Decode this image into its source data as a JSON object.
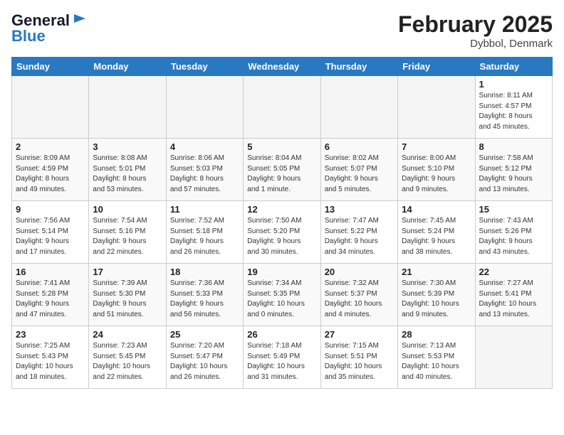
{
  "header": {
    "logo_line1": "General",
    "logo_line2": "Blue",
    "month_title": "February 2025",
    "location": "Dybbol, Denmark"
  },
  "weekdays": [
    "Sunday",
    "Monday",
    "Tuesday",
    "Wednesday",
    "Thursday",
    "Friday",
    "Saturday"
  ],
  "weeks": [
    [
      {
        "day": "",
        "info": ""
      },
      {
        "day": "",
        "info": ""
      },
      {
        "day": "",
        "info": ""
      },
      {
        "day": "",
        "info": ""
      },
      {
        "day": "",
        "info": ""
      },
      {
        "day": "",
        "info": ""
      },
      {
        "day": "1",
        "info": "Sunrise: 8:11 AM\nSunset: 4:57 PM\nDaylight: 8 hours\nand 45 minutes."
      }
    ],
    [
      {
        "day": "2",
        "info": "Sunrise: 8:09 AM\nSunset: 4:59 PM\nDaylight: 8 hours\nand 49 minutes."
      },
      {
        "day": "3",
        "info": "Sunrise: 8:08 AM\nSunset: 5:01 PM\nDaylight: 8 hours\nand 53 minutes."
      },
      {
        "day": "4",
        "info": "Sunrise: 8:06 AM\nSunset: 5:03 PM\nDaylight: 8 hours\nand 57 minutes."
      },
      {
        "day": "5",
        "info": "Sunrise: 8:04 AM\nSunset: 5:05 PM\nDaylight: 9 hours\nand 1 minute."
      },
      {
        "day": "6",
        "info": "Sunrise: 8:02 AM\nSunset: 5:07 PM\nDaylight: 9 hours\nand 5 minutes."
      },
      {
        "day": "7",
        "info": "Sunrise: 8:00 AM\nSunset: 5:10 PM\nDaylight: 9 hours\nand 9 minutes."
      },
      {
        "day": "8",
        "info": "Sunrise: 7:58 AM\nSunset: 5:12 PM\nDaylight: 9 hours\nand 13 minutes."
      }
    ],
    [
      {
        "day": "9",
        "info": "Sunrise: 7:56 AM\nSunset: 5:14 PM\nDaylight: 9 hours\nand 17 minutes."
      },
      {
        "day": "10",
        "info": "Sunrise: 7:54 AM\nSunset: 5:16 PM\nDaylight: 9 hours\nand 22 minutes."
      },
      {
        "day": "11",
        "info": "Sunrise: 7:52 AM\nSunset: 5:18 PM\nDaylight: 9 hours\nand 26 minutes."
      },
      {
        "day": "12",
        "info": "Sunrise: 7:50 AM\nSunset: 5:20 PM\nDaylight: 9 hours\nand 30 minutes."
      },
      {
        "day": "13",
        "info": "Sunrise: 7:47 AM\nSunset: 5:22 PM\nDaylight: 9 hours\nand 34 minutes."
      },
      {
        "day": "14",
        "info": "Sunrise: 7:45 AM\nSunset: 5:24 PM\nDaylight: 9 hours\nand 38 minutes."
      },
      {
        "day": "15",
        "info": "Sunrise: 7:43 AM\nSunset: 5:26 PM\nDaylight: 9 hours\nand 43 minutes."
      }
    ],
    [
      {
        "day": "16",
        "info": "Sunrise: 7:41 AM\nSunset: 5:28 PM\nDaylight: 9 hours\nand 47 minutes."
      },
      {
        "day": "17",
        "info": "Sunrise: 7:39 AM\nSunset: 5:30 PM\nDaylight: 9 hours\nand 51 minutes."
      },
      {
        "day": "18",
        "info": "Sunrise: 7:36 AM\nSunset: 5:33 PM\nDaylight: 9 hours\nand 56 minutes."
      },
      {
        "day": "19",
        "info": "Sunrise: 7:34 AM\nSunset: 5:35 PM\nDaylight: 10 hours\nand 0 minutes."
      },
      {
        "day": "20",
        "info": "Sunrise: 7:32 AM\nSunset: 5:37 PM\nDaylight: 10 hours\nand 4 minutes."
      },
      {
        "day": "21",
        "info": "Sunrise: 7:30 AM\nSunset: 5:39 PM\nDaylight: 10 hours\nand 9 minutes."
      },
      {
        "day": "22",
        "info": "Sunrise: 7:27 AM\nSunset: 5:41 PM\nDaylight: 10 hours\nand 13 minutes."
      }
    ],
    [
      {
        "day": "23",
        "info": "Sunrise: 7:25 AM\nSunset: 5:43 PM\nDaylight: 10 hours\nand 18 minutes."
      },
      {
        "day": "24",
        "info": "Sunrise: 7:23 AM\nSunset: 5:45 PM\nDaylight: 10 hours\nand 22 minutes."
      },
      {
        "day": "25",
        "info": "Sunrise: 7:20 AM\nSunset: 5:47 PM\nDaylight: 10 hours\nand 26 minutes."
      },
      {
        "day": "26",
        "info": "Sunrise: 7:18 AM\nSunset: 5:49 PM\nDaylight: 10 hours\nand 31 minutes."
      },
      {
        "day": "27",
        "info": "Sunrise: 7:15 AM\nSunset: 5:51 PM\nDaylight: 10 hours\nand 35 minutes."
      },
      {
        "day": "28",
        "info": "Sunrise: 7:13 AM\nSunset: 5:53 PM\nDaylight: 10 hours\nand 40 minutes."
      },
      {
        "day": "",
        "info": ""
      }
    ]
  ]
}
